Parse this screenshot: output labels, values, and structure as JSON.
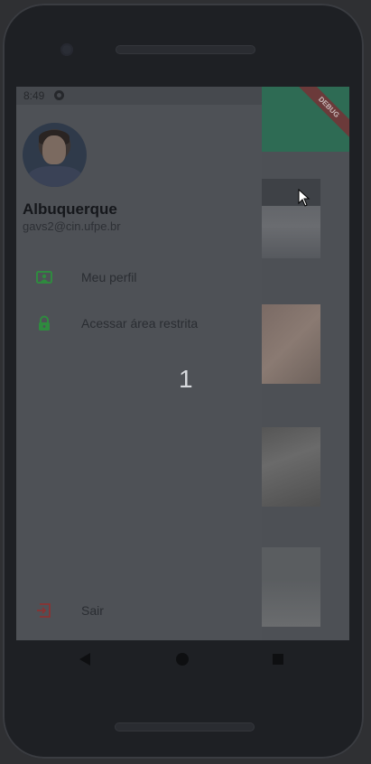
{
  "status_bar": {
    "time": "8:49"
  },
  "debug_banner": {
    "label": "DEBUG"
  },
  "drawer": {
    "user": {
      "name": "Albuquerque",
      "email": "gavs2@cin.ufpe.br"
    },
    "items": [
      {
        "label": "Meu perfil",
        "icon": "profile-card-icon"
      },
      {
        "label": "Acessar área restrita",
        "icon": "lock-icon"
      }
    ],
    "logout": {
      "label": "Sair",
      "icon": "logout-icon"
    }
  },
  "overlay_counter": "1",
  "colors": {
    "accent_green": "#2f8a3f",
    "logout_red": "#8a3232",
    "app_bar": "#2e6b54"
  }
}
